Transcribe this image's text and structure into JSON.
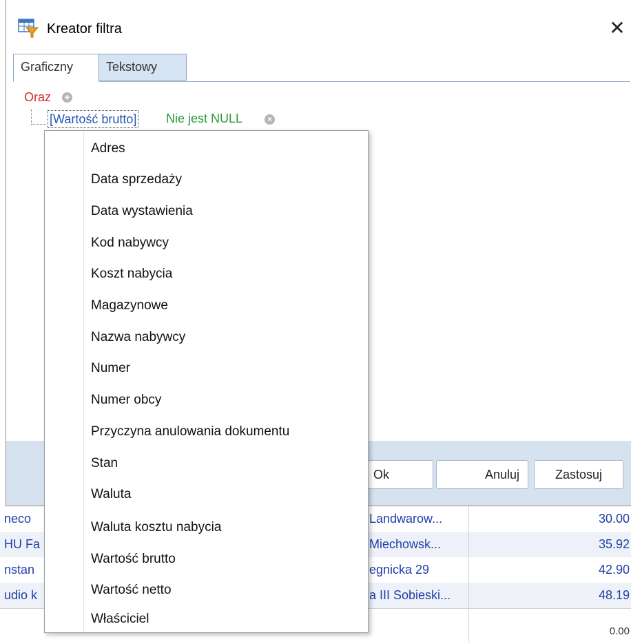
{
  "window": {
    "title": "Kreator filtra",
    "close_glyph": "✕"
  },
  "tabs": [
    {
      "label": "Graficzny",
      "active": true
    },
    {
      "label": "Tekstowy",
      "active": false
    }
  ],
  "filter": {
    "group_operator": "Oraz",
    "condition": {
      "field": "[Wartość brutto]",
      "operator": "Nie jest NULL"
    }
  },
  "buttons": {
    "ok": "Ok",
    "cancel": "Anuluj",
    "apply": "Zastosuj"
  },
  "dropdown": {
    "items": [
      "Adres",
      "Data sprzedaży",
      "Data wystawienia",
      "Kod nabywcy",
      "Koszt nabycia",
      "Magazynowe",
      "Nazwa nabywcy",
      "Numer",
      "Numer obcy",
      "Przyczyna anulowania dokumentu",
      "Stan",
      "Waluta",
      "Waluta kosztu nabycia",
      "Wartość brutto",
      "Wartość netto",
      "Właściciel"
    ]
  },
  "background_grid": {
    "rows": [
      {
        "name": "neco",
        "address": "Landwarow...",
        "amount": "30.00"
      },
      {
        "name": "HU Fa",
        "address": "Miechowsk...",
        "amount": "35.92"
      },
      {
        "name": "nstan",
        "address": "egnicka 29",
        "amount": "42.90"
      },
      {
        "name": "udio k",
        "address": "a III Sobieski...",
        "amount": "48.19"
      }
    ],
    "partial_amount": "0.00"
  },
  "colors": {
    "group_operator": "#d42b2b",
    "field": "#2457b7",
    "operator": "#2a9a3a",
    "grid_text": "#1f3ea8",
    "footer_bg": "#d6e2f0",
    "tab_inactive_bg": "#d6e3f3"
  }
}
